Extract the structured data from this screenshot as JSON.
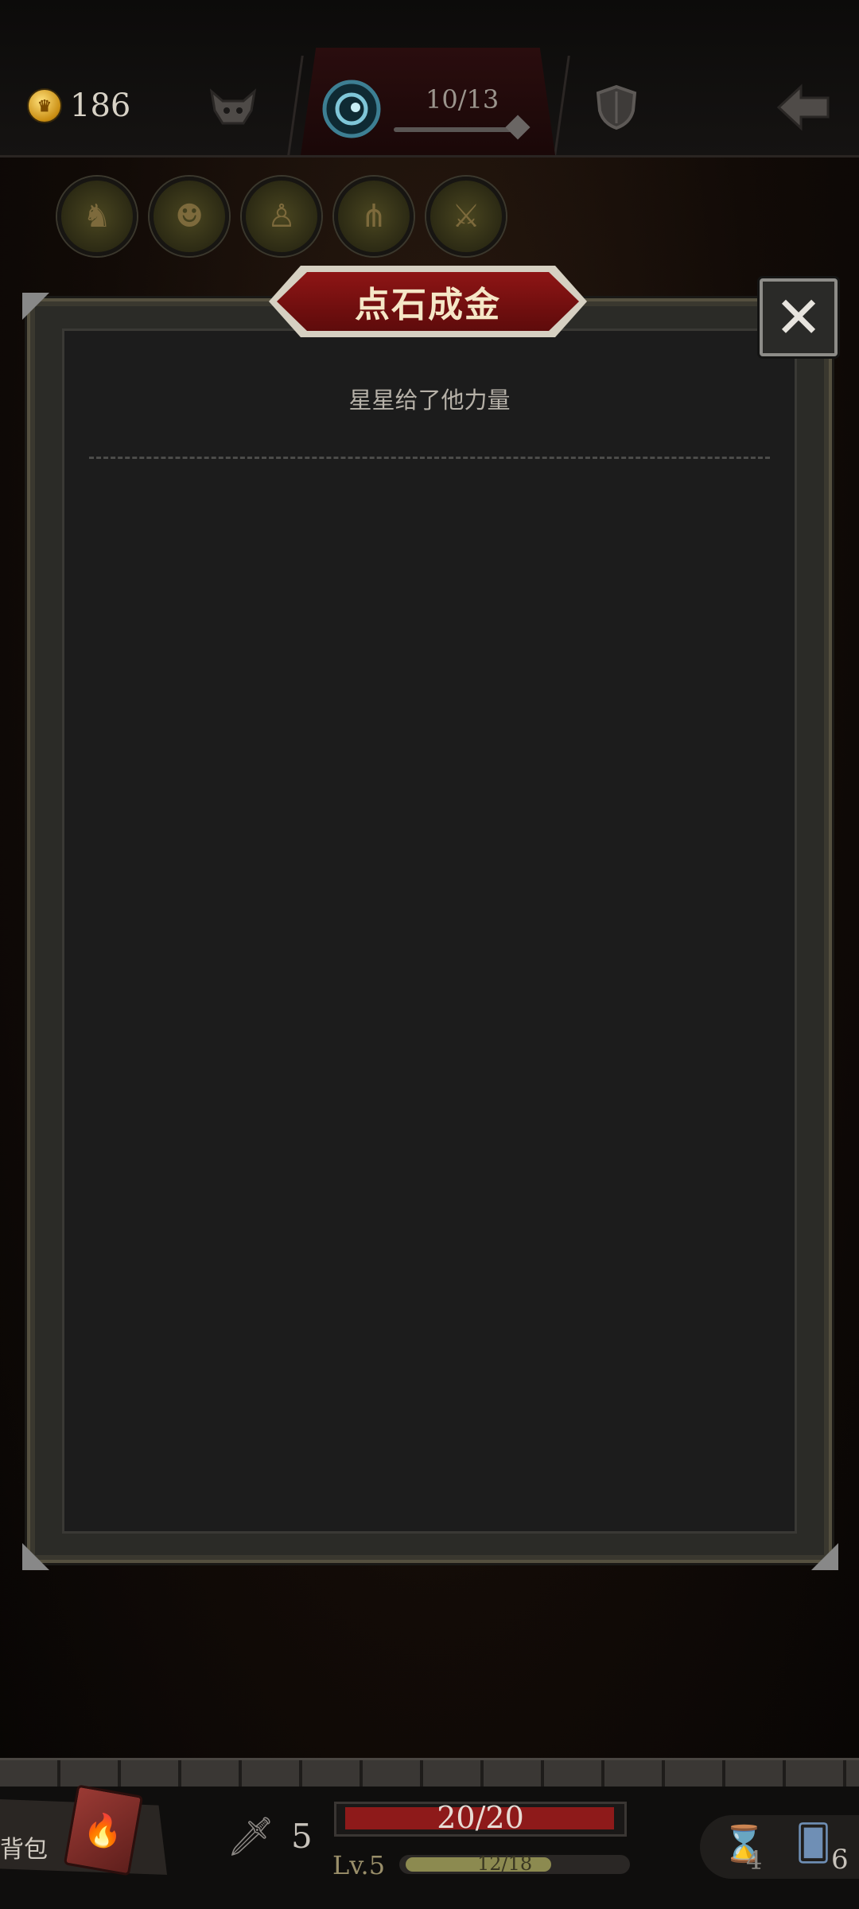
{
  "topbar": {
    "coins": "186",
    "floor_progress": "10/13"
  },
  "relics": [
    {
      "icon": "lion-relic-icon"
    },
    {
      "icon": "pirate-relic-icon"
    },
    {
      "icon": "figure-relic-icon"
    },
    {
      "icon": "wheat-relic-icon"
    },
    {
      "icon": "warriors-relic-icon"
    }
  ],
  "modal": {
    "title": "点石成金",
    "subtitle": "星星给了他力量",
    "close_symbol": "✕"
  },
  "bottom": {
    "bag_label": "背包",
    "attack": "5",
    "hp": "20/20",
    "level": "Lv.5",
    "xp": "12/18",
    "xp_fraction": 0.667,
    "hourglass_count": "4",
    "cards_count": "6"
  },
  "colors": {
    "title_banner": "#8e1515",
    "hp_bar": "#8e1a1a",
    "coin": "#e0a82a"
  }
}
